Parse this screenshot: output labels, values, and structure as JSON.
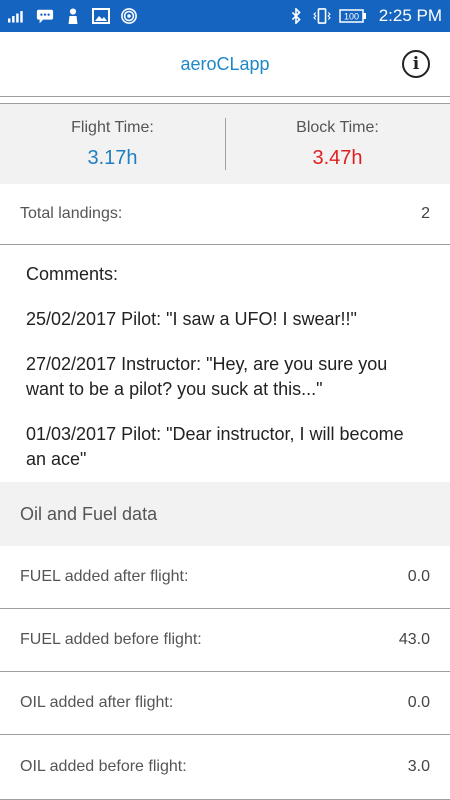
{
  "status_bar": {
    "time": "2:25 PM",
    "battery": "100"
  },
  "header": {
    "title": "aeroCLapp",
    "info_icon": "i"
  },
  "times": {
    "flight_label": "Flight Time:",
    "flight_value": "3.17h",
    "block_label": "Block Time:",
    "block_value": "3.47h",
    "flight_color": "#1e7fc0",
    "block_color": "#e02020"
  },
  "landings": {
    "label": "Total landings:",
    "value": "2"
  },
  "comments": {
    "title": "Comments:",
    "entries": [
      "25/02/2017 Pilot: \"I saw a UFO! I swear!!\"",
      "27/02/2017 Instructor: \"Hey, are you sure you want to be a pilot? you suck at this...\"",
      "01/03/2017 Pilot: \"Dear instructor, I will become an ace\""
    ]
  },
  "oil_fuel": {
    "title": "Oil and Fuel data",
    "rows": [
      {
        "label": "FUEL added after flight:",
        "value": "0.0"
      },
      {
        "label": "FUEL added before flight:",
        "value": "43.0"
      },
      {
        "label": "OIL added after flight:",
        "value": "0.0"
      },
      {
        "label": "OIL added before flight:",
        "value": "3.0"
      }
    ]
  }
}
